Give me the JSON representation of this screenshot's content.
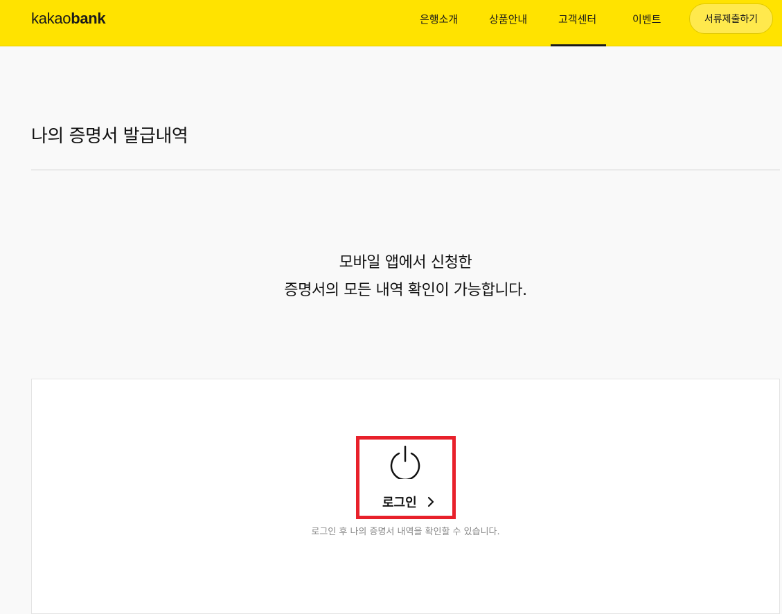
{
  "header": {
    "logo_light": "kakao",
    "logo_bold": "bank",
    "nav": [
      {
        "label": "은행소개"
      },
      {
        "label": "상품안내"
      },
      {
        "label": "고객센터",
        "active": true
      },
      {
        "label": "이벤트"
      }
    ],
    "submit_label": "서류제출하기"
  },
  "page": {
    "title": "나의 증명서 발급내역",
    "intro_line1": "모바일 앱에서 신청한",
    "intro_line2": "증명서의 모든 내역 확인이 가능합니다."
  },
  "login": {
    "icon": "power-icon",
    "label": "로그인",
    "hint": "로그인 후 나의 증명서 내역을 확인할 수 있습니다."
  },
  "colors": {
    "brand_yellow": "#ffe300",
    "highlight_red": "#e8212b"
  }
}
